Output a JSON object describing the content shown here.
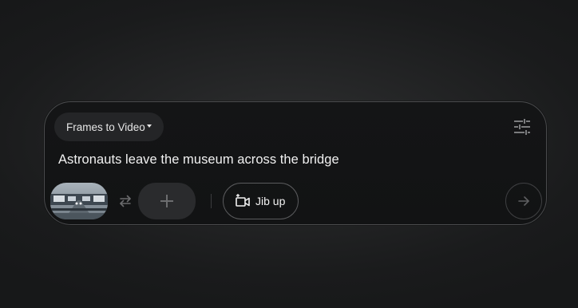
{
  "composer": {
    "mode_label": "Frames to Video",
    "prompt_text": "Astronauts leave the museum across the bridge",
    "camera_motion_label": "Jib up"
  },
  "icons": {
    "mode_caret": "caret-down-icon",
    "settings": "tune-sliders-icon",
    "swap": "swap-arrows-icon",
    "add": "plus-icon",
    "camera": "video-camera-sparkle-icon",
    "send": "arrow-right-icon"
  },
  "colors": {
    "panel_border": "#4a4b4d",
    "chip_bg": "#242527",
    "text": "#f1f1f1",
    "muted_icon": "#6a6b6d"
  }
}
